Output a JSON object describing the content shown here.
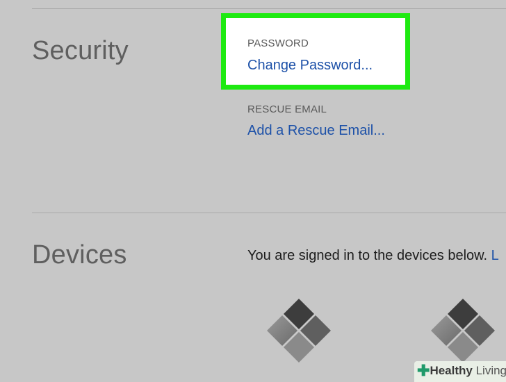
{
  "security": {
    "title": "Security",
    "password": {
      "label": "PASSWORD",
      "link": "Change Password..."
    },
    "rescue_email": {
      "label": "RESCUE EMAIL",
      "link": "Add a Rescue Email..."
    }
  },
  "devices": {
    "title": "Devices",
    "description": "You are signed in to the devices below.",
    "overflow_link": "L",
    "items": [
      {
        "icon": "device-windows-icon"
      },
      {
        "icon": "device-windows-icon"
      }
    ]
  },
  "watermark": {
    "brand_bold": "Healthy",
    "brand_light": "Living"
  },
  "colors": {
    "background": "#c7c7c7",
    "highlight_border": "#1eea11",
    "link": "#1d51a8"
  }
}
